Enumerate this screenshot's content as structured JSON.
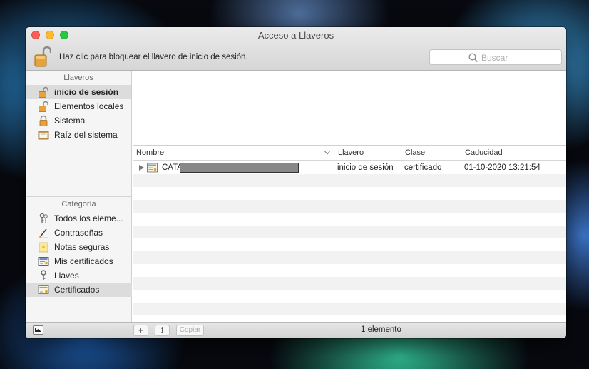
{
  "window": {
    "title": "Acceso a Llaveros"
  },
  "toolbar": {
    "lock_hint": "Haz clic para bloquear el llavero de inicio de sesión."
  },
  "search": {
    "placeholder": "Buscar",
    "value": ""
  },
  "sidebar": {
    "keychains_header": "Llaveros",
    "keychains": [
      {
        "label": "inicio de sesión",
        "icon": "unlocked-padlock-icon",
        "selected": true
      },
      {
        "label": "Elementos locales",
        "icon": "unlocked-padlock-icon"
      },
      {
        "label": "Sistema",
        "icon": "locked-padlock-icon"
      },
      {
        "label": "Raíz del sistema",
        "icon": "certificate-folder-icon"
      }
    ],
    "category_header": "Categoría",
    "categories": [
      {
        "label": "Todos los eleme...",
        "icon": "keys-icon"
      },
      {
        "label": "Contraseñas",
        "icon": "pen-icon"
      },
      {
        "label": "Notas seguras",
        "icon": "note-icon"
      },
      {
        "label": "Mis certificados",
        "icon": "my-certificate-icon"
      },
      {
        "label": "Llaves",
        "icon": "key-icon"
      },
      {
        "label": "Certificados",
        "icon": "certificate-icon",
        "selected": true
      }
    ]
  },
  "table": {
    "headers": {
      "name": "Nombre",
      "keychain": "Llavero",
      "kind": "Clase",
      "expires": "Caducidad"
    },
    "rows": [
      {
        "name": "CATA",
        "keychain": "inicio de sesión",
        "kind": "certificado",
        "expires": "01-10-2020 13:21:54"
      }
    ]
  },
  "bottombar": {
    "add_label": "+",
    "info_label": "i",
    "copy_label": "Copiar",
    "status": "1 elemento"
  },
  "colors": {
    "selection": "#dcdcdc",
    "close": "#fc5f57",
    "minimize": "#fdbc2e",
    "zoom": "#28c840",
    "lock_gold": "#e8a23a"
  }
}
